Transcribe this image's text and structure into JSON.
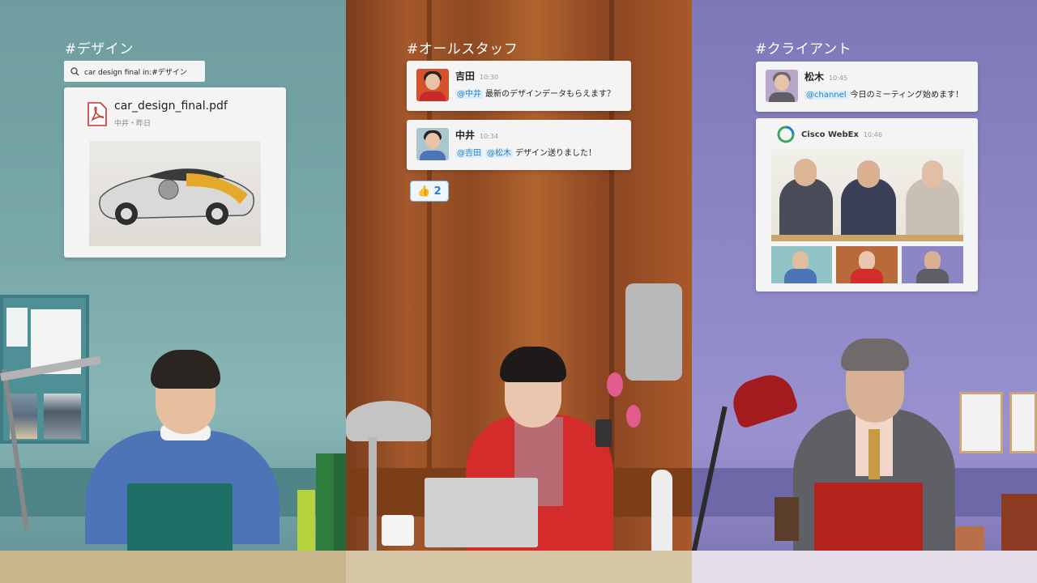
{
  "panel1": {
    "channel": "#デザイン",
    "search": {
      "query": "car design final in:#デザイン"
    },
    "file": {
      "name": "car_design_final.pdf",
      "meta": "中井・昨日",
      "icon": "pdf-icon"
    }
  },
  "panel2": {
    "channel": "#オールスタッフ",
    "messages": [
      {
        "name": "吉田",
        "time": "10:30",
        "mention": "@中井",
        "text": "最新のデザインデータもらえます？"
      },
      {
        "name": "中井",
        "time": "10:34",
        "mentions": [
          "@吉田",
          "@松木"
        ],
        "text": "デザイン送りました！"
      }
    ],
    "reaction": {
      "emoji": "👍",
      "count": "2"
    }
  },
  "panel3": {
    "channel": "#クライアント",
    "message": {
      "name": "松木",
      "time": "10:45",
      "mention": "@channel",
      "text": "今日のミーティング始めます！"
    },
    "webex": {
      "app": "Cisco WebEx",
      "time": "10:46"
    }
  },
  "colors": {
    "mention_bg": "#dbeefa",
    "mention_text": "#2c7ec4",
    "pdf_red": "#c8352d"
  }
}
